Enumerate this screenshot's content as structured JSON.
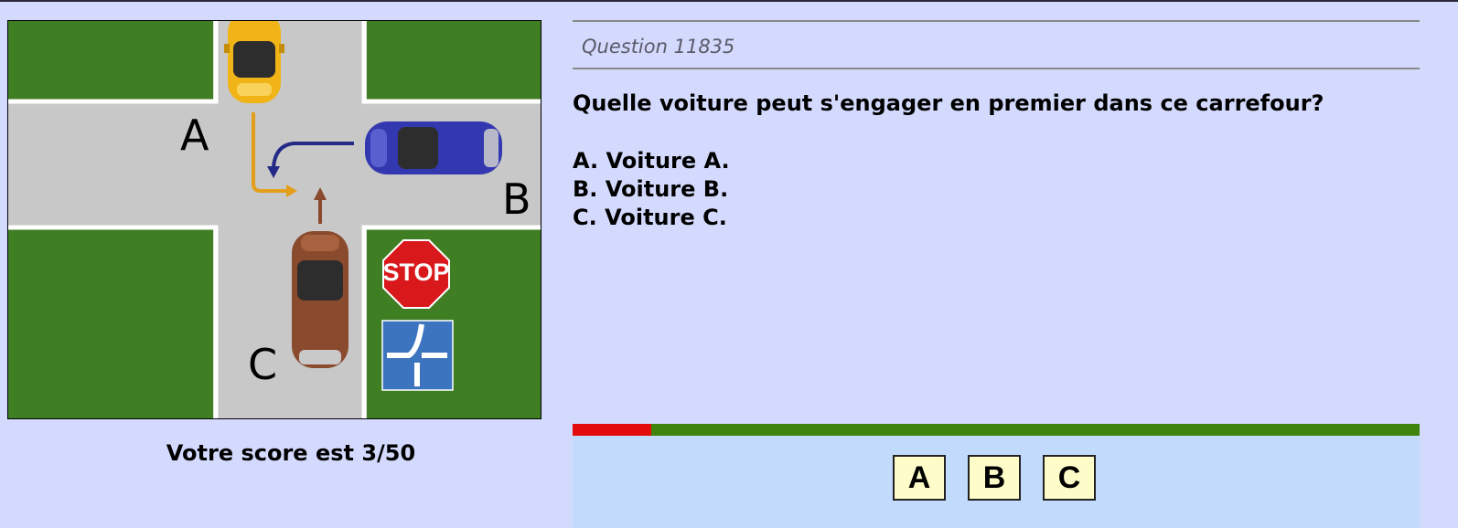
{
  "question": {
    "number_label": "Question 11835",
    "text": "Quelle voiture peut s'engager en premier dans ce carrefour?",
    "options": [
      "A. Voiture A.",
      "B. Voiture B.",
      "C. Voiture C."
    ]
  },
  "scene": {
    "car_labels": {
      "a": "A",
      "b": "B",
      "c": "C"
    },
    "stop_sign_text": "STOP",
    "colors": {
      "car_a": "#f0b417",
      "car_b": "#3438b0",
      "car_c": "#8a4a2e",
      "grass": "#3f7e23",
      "road": "#c8c8c8"
    }
  },
  "score": {
    "label": "Votre score est 3/50"
  },
  "progress": {
    "fraction_wrong": 0.093
  },
  "answers": {
    "labels": [
      "A",
      "B",
      "C"
    ]
  }
}
